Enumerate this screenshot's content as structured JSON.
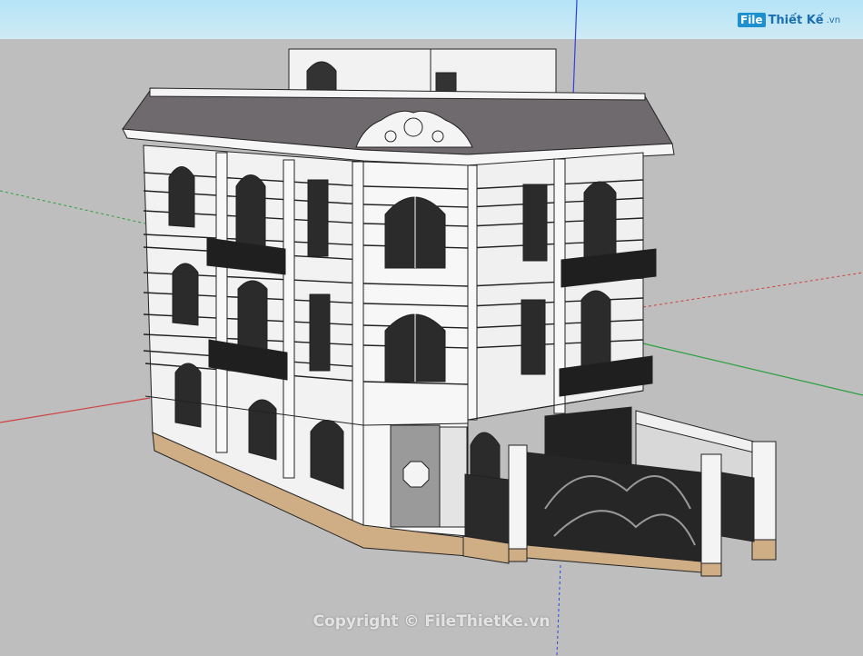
{
  "viewport": {
    "description_colors": {
      "sky": "#c4e8f6",
      "ground": "#bebebe",
      "wall": "#f4f4f4",
      "roof": "#6f6a6e",
      "base": "#cfae86",
      "iron": "#2a2a2a",
      "axis_red": "#d04040",
      "axis_green": "#2aa040",
      "axis_blue": "#3040e0"
    }
  },
  "brand": {
    "logo_box": "File",
    "logo_name": "Thiết Kế",
    "logo_suffix": ".vn"
  },
  "watermark": {
    "text": "Copyright © FileThietKe.vn"
  }
}
